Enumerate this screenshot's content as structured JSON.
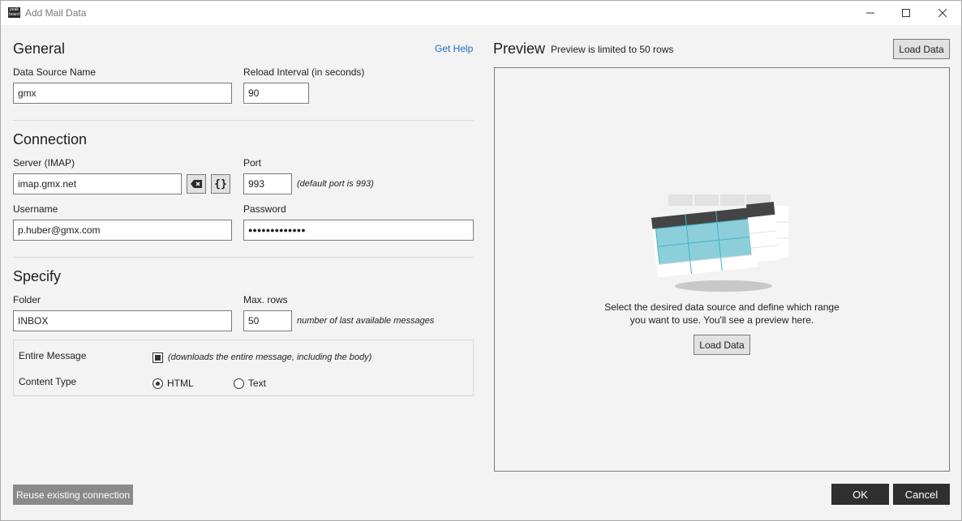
{
  "window": {
    "title": "Add Mail Data",
    "app_icon_text": "peak board"
  },
  "general": {
    "title": "General",
    "get_help": "Get Help",
    "data_source_name_label": "Data Source Name",
    "data_source_name_value": "gmx",
    "reload_interval_label": "Reload Interval (in seconds)",
    "reload_interval_value": "90"
  },
  "connection": {
    "title": "Connection",
    "server_label": "Server (IMAP)",
    "server_value": "imap.gmx.net",
    "variable_button": "{}",
    "port_label": "Port",
    "port_value": "993",
    "port_hint": "(default port is 993)",
    "username_label": "Username",
    "username_value": "p.huber@gmx.com",
    "password_label": "Password",
    "password_value": "●●●●●●●●●●●●●"
  },
  "specify": {
    "title": "Specify",
    "folder_label": "Folder",
    "folder_value": "INBOX",
    "max_rows_label": "Max. rows",
    "max_rows_value": "50",
    "max_rows_hint": "number of last available messages",
    "entire_message_label": "Entire Message",
    "entire_message_checked": true,
    "entire_message_hint": "(downloads the entire message, including the body)",
    "content_type_label": "Content Type",
    "content_type_options": [
      "HTML",
      "Text"
    ],
    "content_type_selected": "HTML"
  },
  "preview": {
    "title": "Preview",
    "subtitle": "Preview is limited to 50 rows",
    "load_data_top": "Load Data",
    "empty_line1": "Select the desired data source and define which range",
    "empty_line2": "you want to use. You'll see a preview here.",
    "load_data_center": "Load Data"
  },
  "footer": {
    "reuse_connection": "Reuse existing connection",
    "ok": "OK",
    "cancel": "Cancel"
  },
  "colors": {
    "accent_link": "#1a6fc4",
    "table_header": "#444444",
    "table_cells": "#8ccfdb",
    "table_cell_border": "#3fb3c6"
  },
  "icons": [
    "clear-text-icon",
    "minimize-icon",
    "maximize-icon",
    "close-icon",
    "table-illustration-icon"
  ]
}
